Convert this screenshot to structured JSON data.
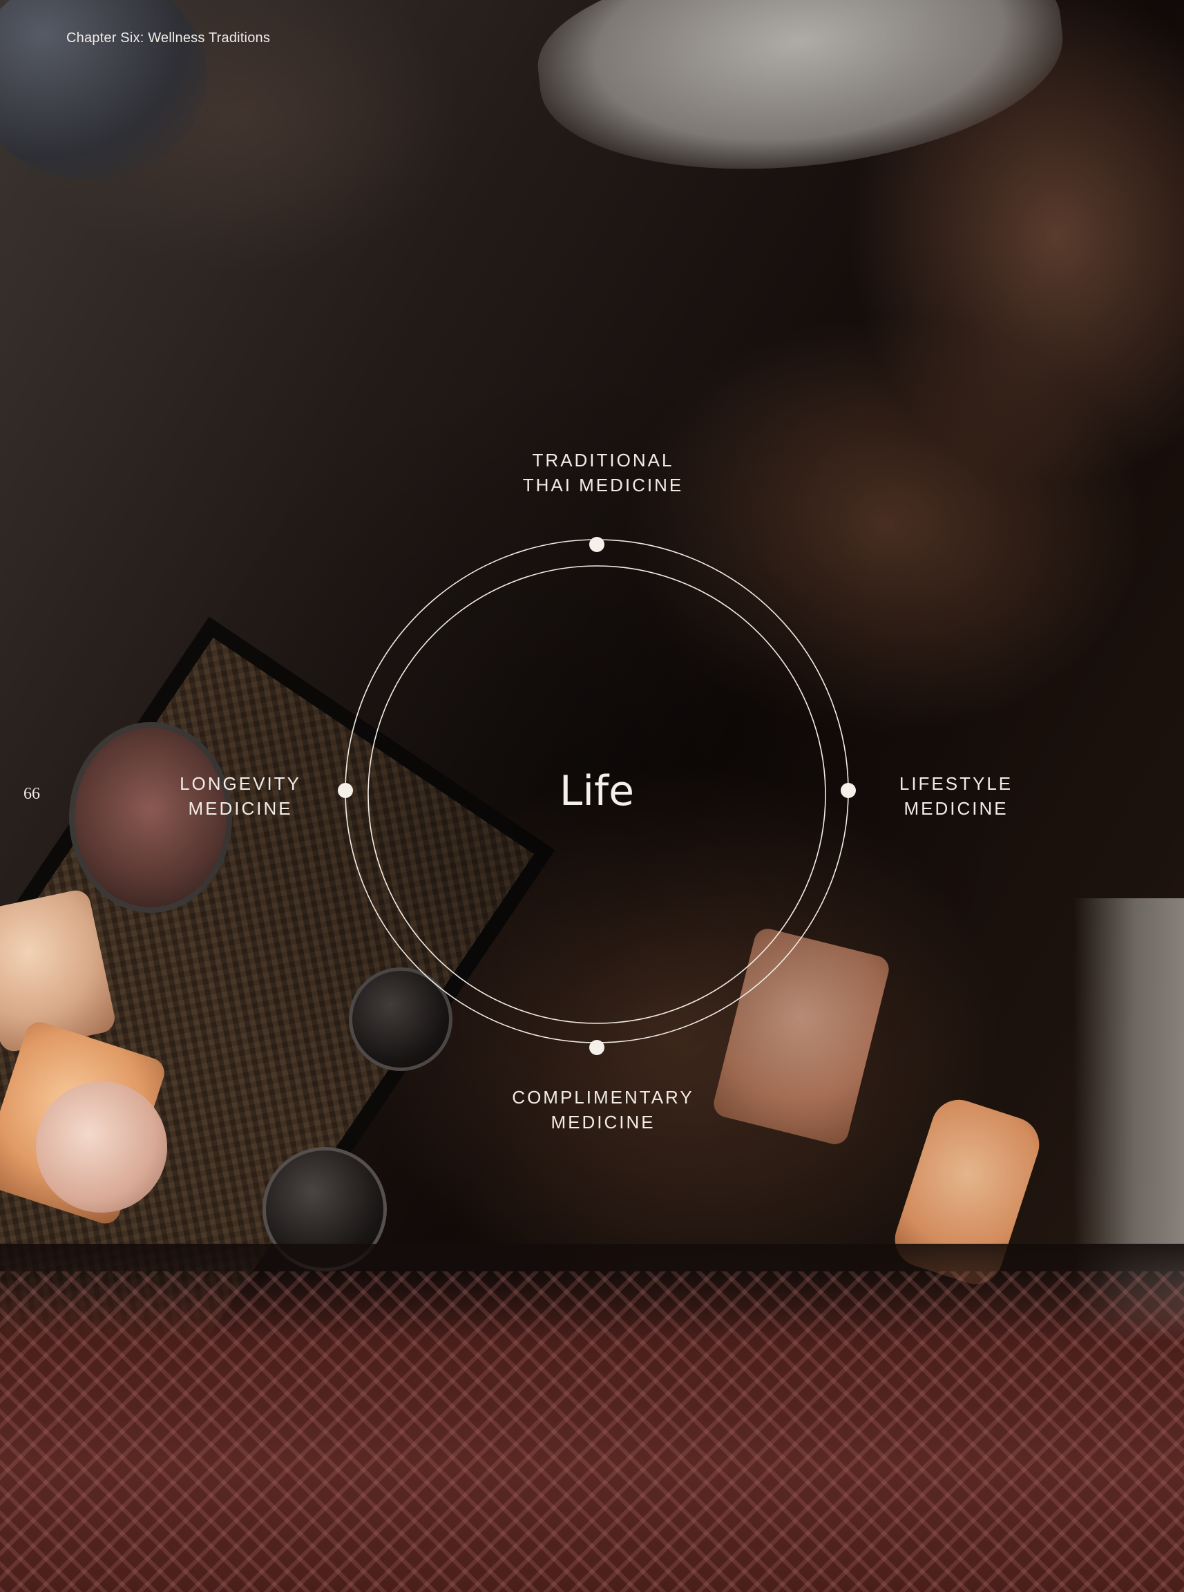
{
  "header": {
    "chapter": "Chapter Six: Wellness Traditions"
  },
  "page": {
    "number": "66"
  },
  "diagram": {
    "center": "Life",
    "nodes": {
      "top": {
        "line1": "TRADITIONAL",
        "line2": "THAI MEDICINE"
      },
      "left": {
        "line1": "LONGEVITY",
        "line2": "MEDICINE"
      },
      "right": {
        "line1": "LIFESTYLE",
        "line2": "MEDICINE"
      },
      "bottom": {
        "line1": "COMPLIMENTARY",
        "line2": "MEDICINE"
      }
    },
    "line_color": "#f3ece6"
  },
  "background": {
    "subject": "overhead photo of a massage with warm salt stones"
  }
}
